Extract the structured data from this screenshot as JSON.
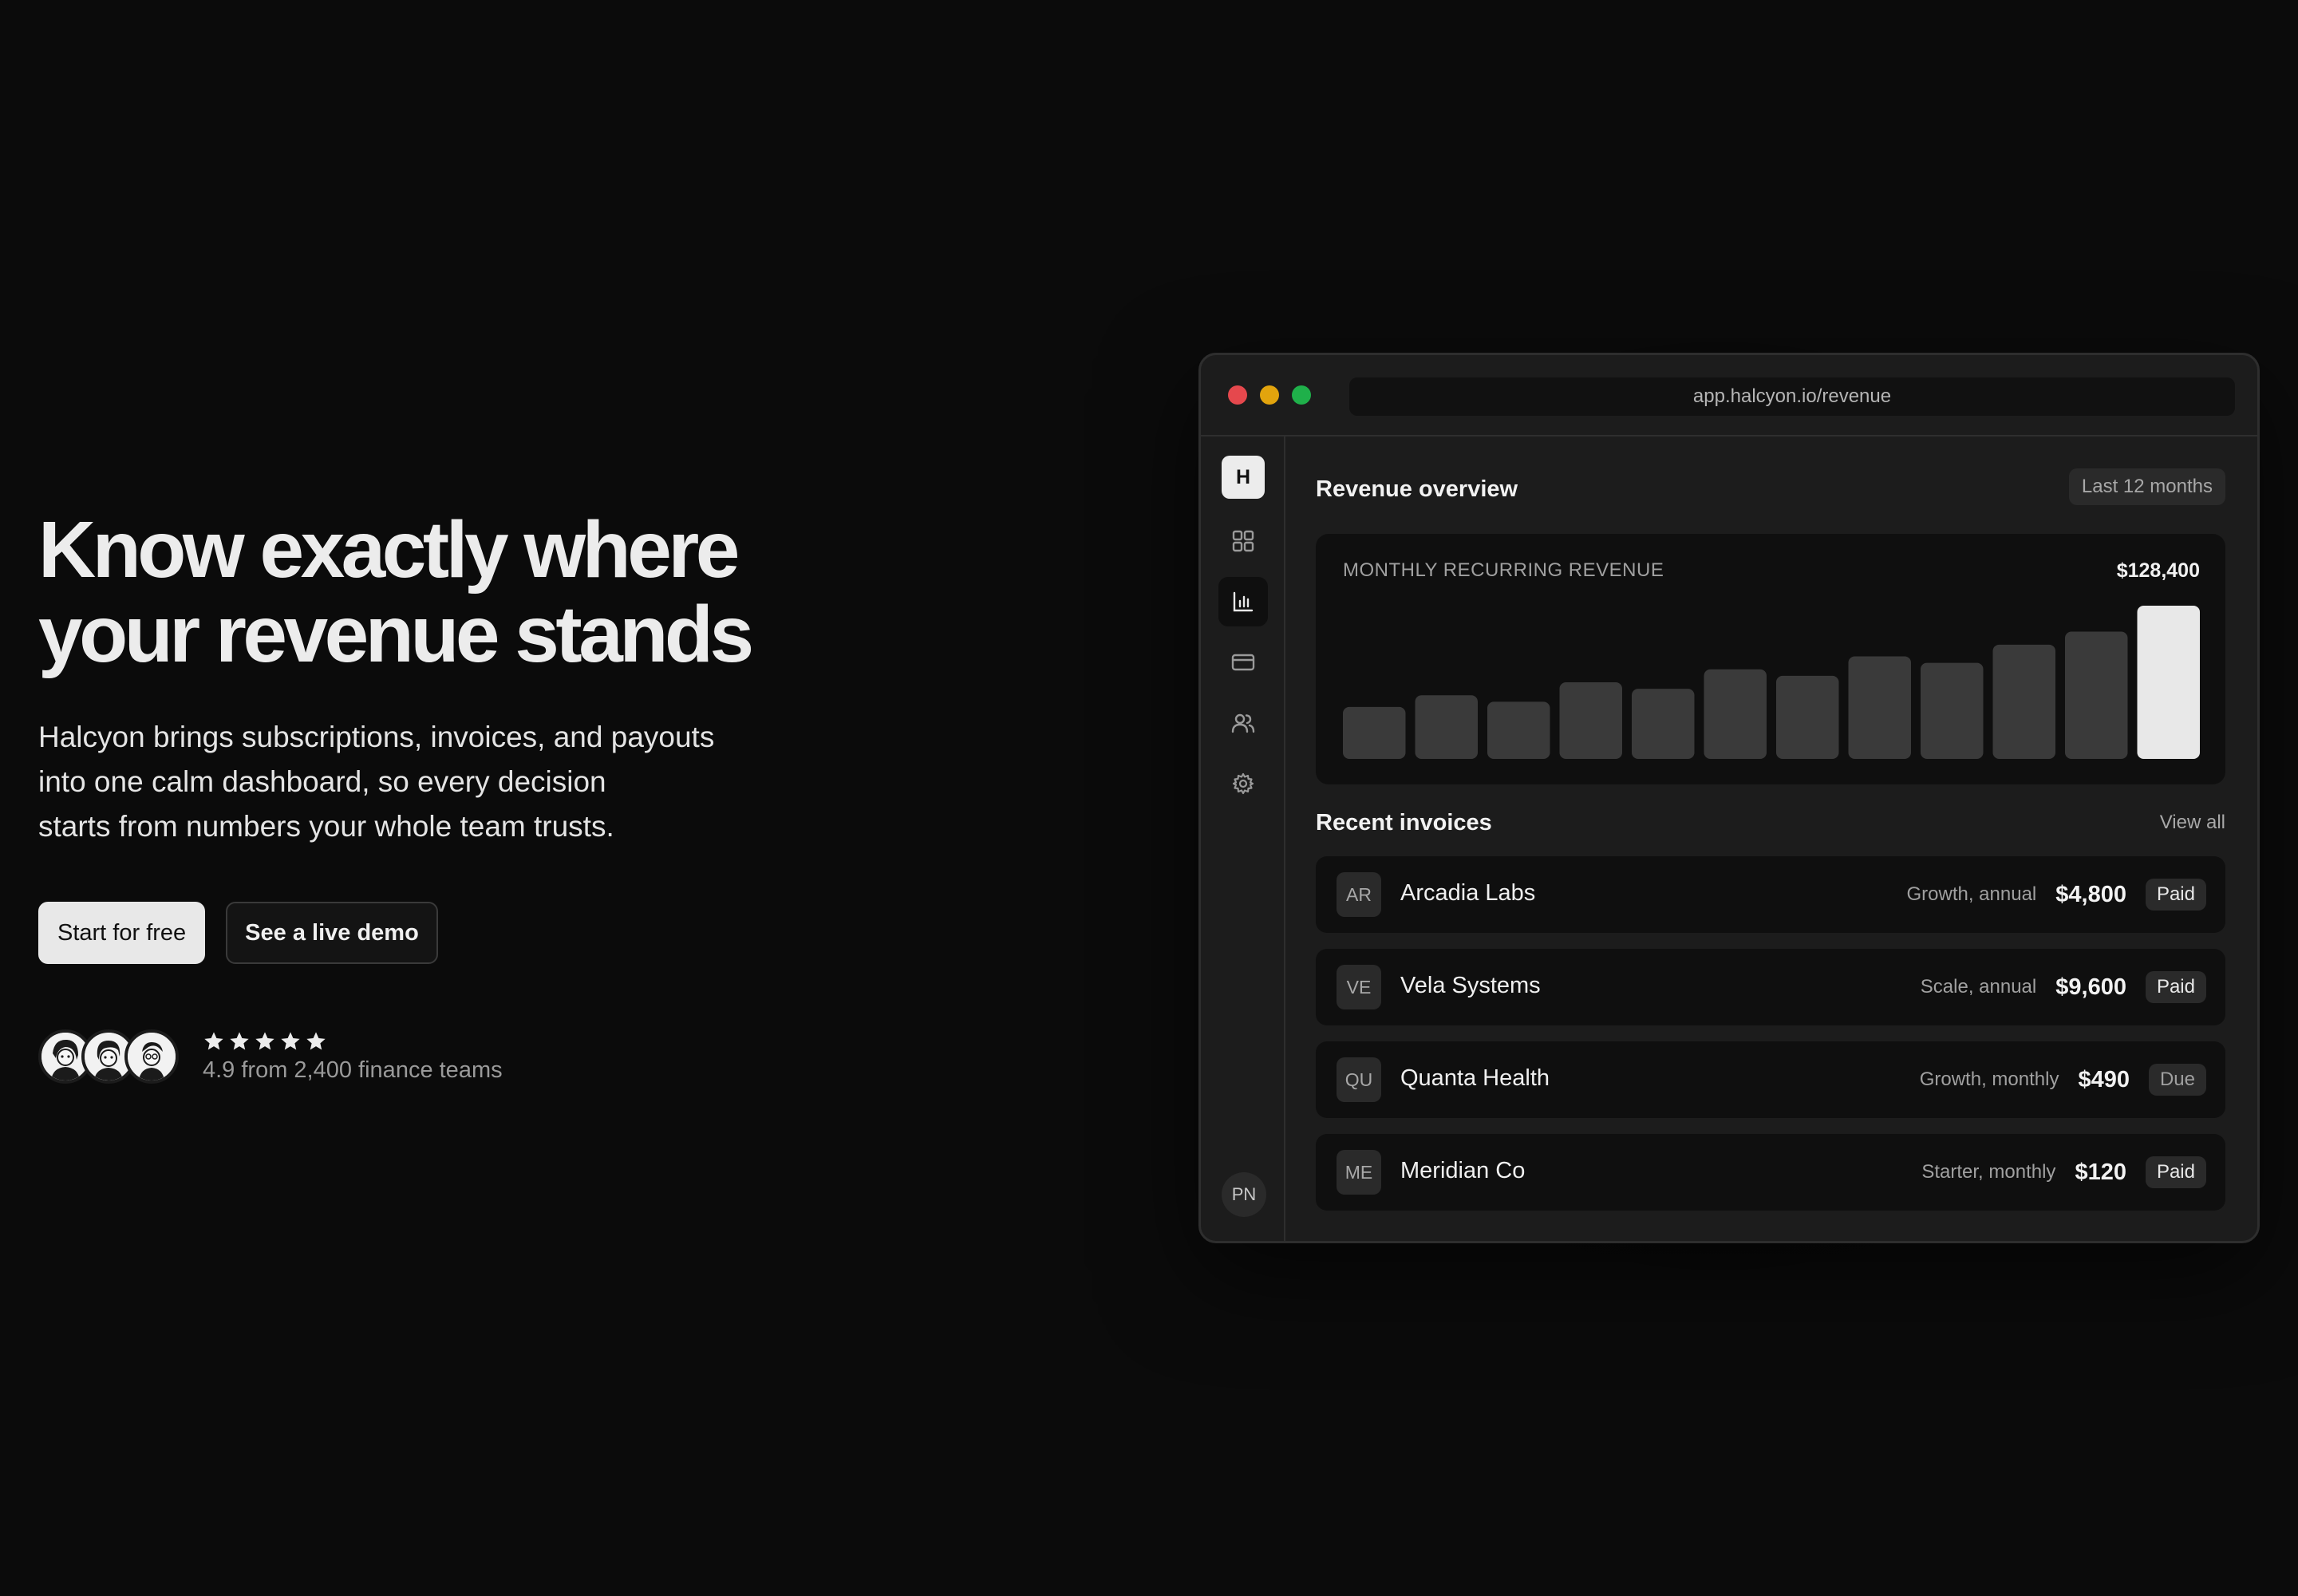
{
  "hero": {
    "headline_line1": "Know exactly where",
    "headline_line2": "your revenue stands",
    "sub_line1": "Halcyon brings subscriptions, invoices, and payouts",
    "sub_line2": "into one calm dashboard, so every decision",
    "sub_line3": "starts from numbers your whole team trusts.",
    "primary_cta": "Start for free",
    "secondary_cta": "See a live demo",
    "rating_stars": 5,
    "rating_text": "4.9 from 2,400 finance teams"
  },
  "window": {
    "url": "app.halcyon.io/revenue",
    "logo_letter": "H",
    "user_initials": "PN",
    "sidebar_icons": [
      "grid-icon",
      "bar-chart-icon",
      "credit-card-icon",
      "users-icon",
      "gear-icon"
    ],
    "active_nav": "bar-chart-icon"
  },
  "overview": {
    "title": "Revenue overview",
    "range": "Last 12 months",
    "metric_label": "MONTHLY RECURRING REVENUE",
    "metric_value": "$128,400"
  },
  "chart_data": {
    "type": "bar",
    "title": "MONTHLY RECURRING REVENUE",
    "values": [
      40,
      49,
      44,
      59,
      54,
      69,
      64,
      79,
      74,
      88,
      98,
      118
    ],
    "ylim": [
      0,
      118
    ],
    "highlight_last": true,
    "colors": {
      "bar": "#3a3a3a",
      "highlight": "#e8e8e8"
    },
    "grid": false
  },
  "invoices": {
    "title": "Recent invoices",
    "view_all": "View all",
    "rows": [
      {
        "initials": "AR",
        "name": "Arcadia Labs",
        "plan": "Growth, annual",
        "amount": "$4,800",
        "status": "Paid"
      },
      {
        "initials": "VE",
        "name": "Vela Systems",
        "plan": "Scale, annual",
        "amount": "$9,600",
        "status": "Paid"
      },
      {
        "initials": "QU",
        "name": "Quanta Health",
        "plan": "Growth, monthly",
        "amount": "$490",
        "status": "Due"
      },
      {
        "initials": "ME",
        "name": "Meridian Co",
        "plan": "Starter, monthly",
        "amount": "$120",
        "status": "Paid"
      }
    ]
  }
}
